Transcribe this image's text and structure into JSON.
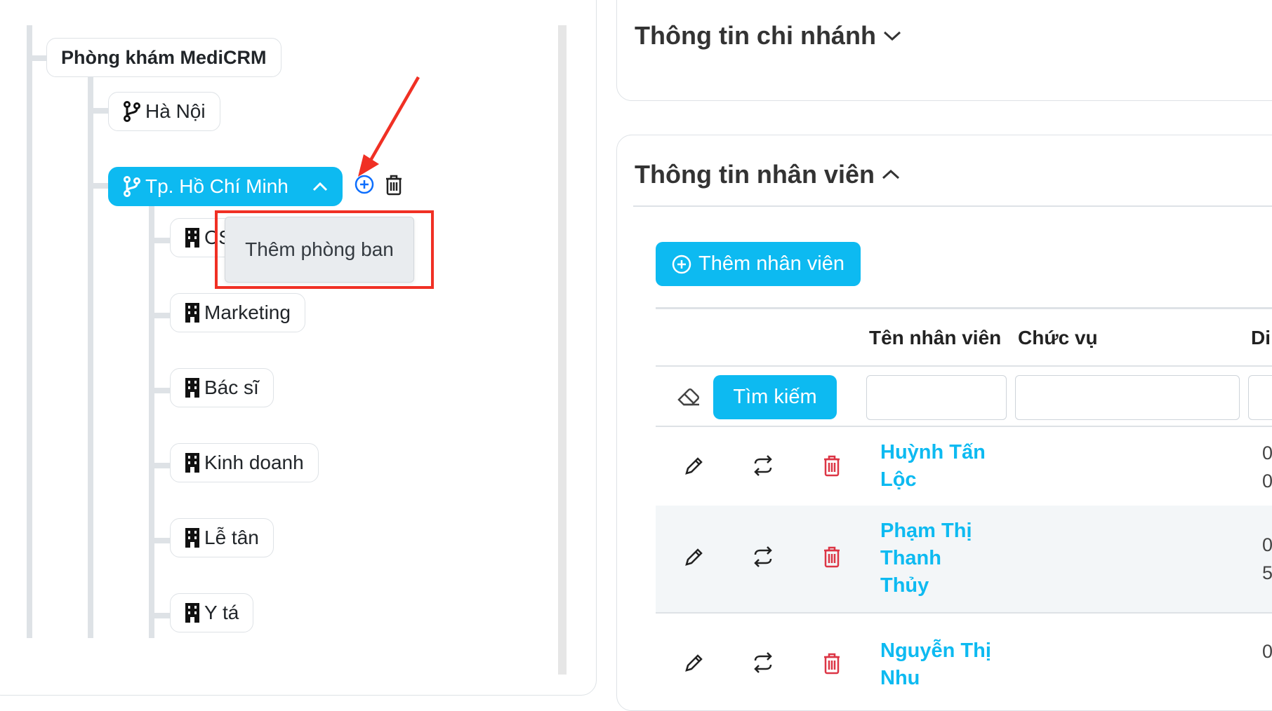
{
  "tree": {
    "root": "Phòng khám MediCRM",
    "branches": [
      {
        "label": "Hà Nội"
      },
      {
        "label": "Tp. Hồ Chí Minh",
        "active": true
      }
    ],
    "departments": [
      "CS",
      "Marketing",
      "Bác sĩ",
      "Kinh doanh",
      "Lễ tân",
      "Y tá"
    ],
    "tooltip": "Thêm phòng ban"
  },
  "branch_info": {
    "title": "Thông tin chi nhánh"
  },
  "staff": {
    "title": "Thông tin nhân viên",
    "add_button": "Thêm nhân viên",
    "columns": [
      "Tên nhân viên",
      "Chức vụ",
      "Di"
    ],
    "search_button": "Tìm kiếm",
    "rows": [
      {
        "name_lines": [
          "Huỳnh Tấn",
          "Lộc"
        ],
        "cut_col": [
          "0",
          "0"
        ]
      },
      {
        "name_lines": [
          "Phạm Thị",
          "Thanh",
          "Thủy"
        ],
        "cut_col": [
          "0",
          "5"
        ]
      },
      {
        "name_lines": [
          "Nguyễn Thị",
          "Nhu"
        ],
        "cut_col": [
          "0"
        ]
      }
    ]
  },
  "colors": {
    "accent": "#0dbaf1",
    "danger": "#dc3545",
    "annotation": "#f03024"
  }
}
